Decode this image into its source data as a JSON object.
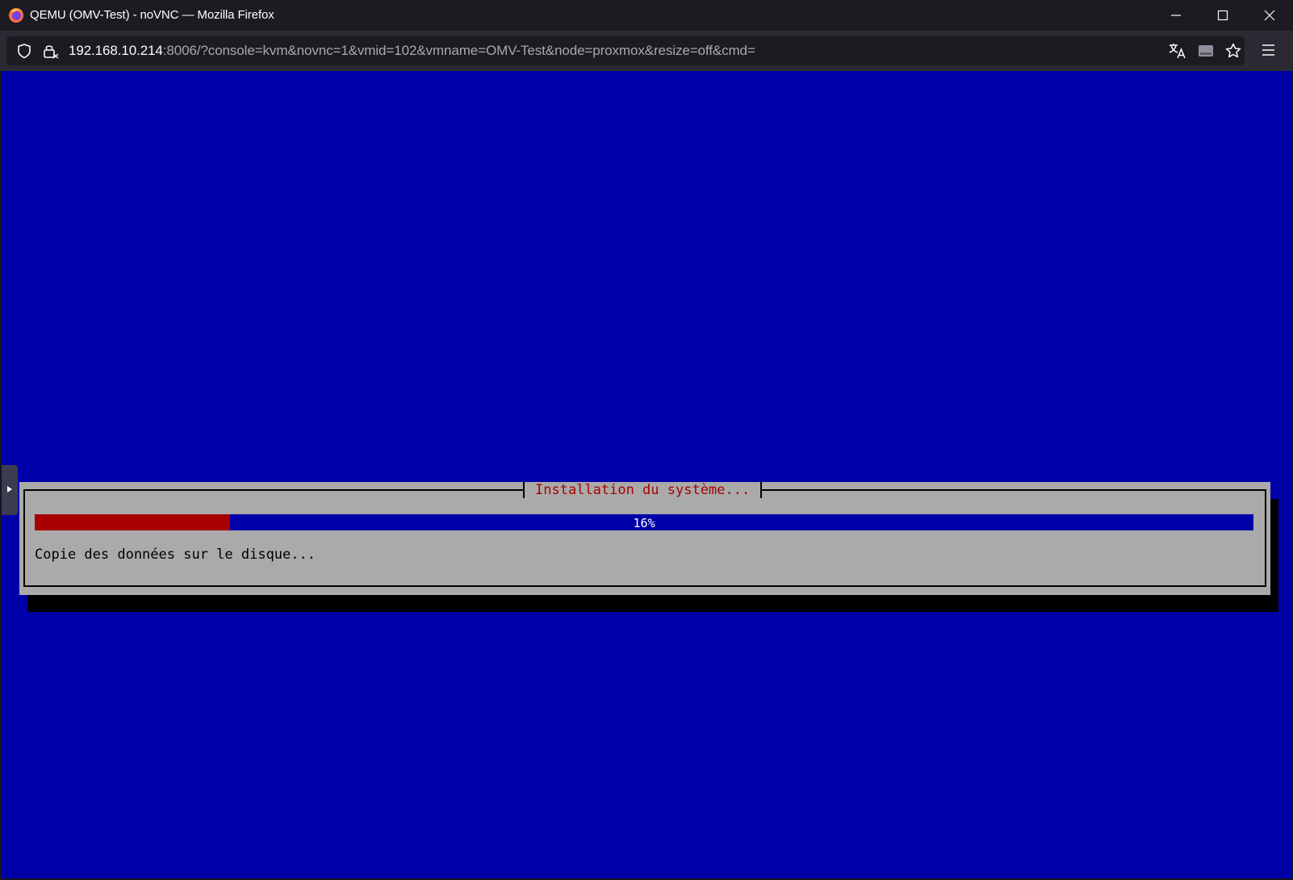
{
  "window": {
    "title": "QEMU (OMV-Test) - noVNC — Mozilla Firefox",
    "controls": [
      "minimize-icon",
      "maximize-icon",
      "close-icon"
    ]
  },
  "toolbar": {
    "url_host": "192.168.10.214",
    "url_rest": ":8006/?console=kvm&novnc=1&vmid=102&vmname=OMV-Test&node=proxmox&resize=off&cmd=",
    "icons": [
      "shield-icon",
      "lock-icon",
      "translate-icon",
      "drive-icon",
      "bookmark-star-icon",
      "menu-icon"
    ]
  },
  "installer": {
    "dialog_title": "Installation du système...",
    "progress_percent": 16,
    "progress_label": "16%",
    "status_message": "Copie des données sur le disque..."
  },
  "colors": {
    "console_background": "#0000a8",
    "dialog_background": "#aaaaaa",
    "progress_fill": "#a80000",
    "title_text": "#a80000"
  }
}
